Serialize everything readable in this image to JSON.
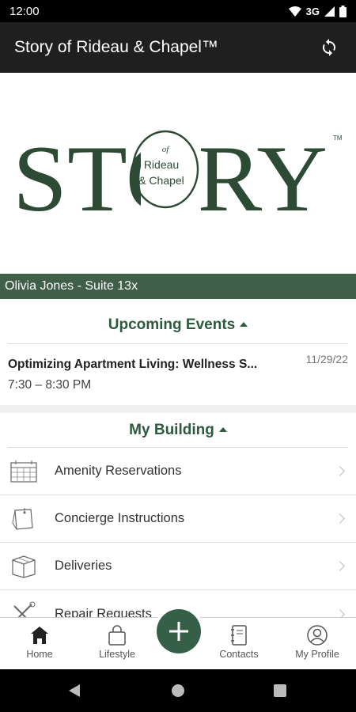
{
  "status_bar": {
    "time": "12:00",
    "network": "3G"
  },
  "app_bar": {
    "title": "Story of Rideau & Chapel™"
  },
  "logo": {
    "main_text": "STORY",
    "of_text": "of",
    "line1": "Rideau",
    "line2": "& Chapel",
    "tm": "TM",
    "color": "#2d4a35"
  },
  "resident": {
    "label": "Olivia Jones - Suite 13x"
  },
  "upcoming_events": {
    "title": "Upcoming Events",
    "events": [
      {
        "title": "Optimizing Apartment Living: Wellness S...",
        "time": "7:30 – 8:30 PM",
        "date": "11/29/22"
      }
    ]
  },
  "my_building": {
    "title": "My Building",
    "items": [
      {
        "label": "Amenity Reservations",
        "icon": "calendar-icon"
      },
      {
        "label": "Concierge Instructions",
        "icon": "notes-icon"
      },
      {
        "label": "Deliveries",
        "icon": "package-icon"
      },
      {
        "label": "Repair Requests",
        "icon": "tools-icon"
      }
    ]
  },
  "bottom_nav": {
    "items": [
      {
        "label": "Home",
        "icon": "home-icon",
        "active": true
      },
      {
        "label": "Lifestyle",
        "icon": "shopping-bag-icon"
      },
      {
        "label": "Contacts",
        "icon": "address-book-icon"
      },
      {
        "label": "My Profile",
        "icon": "user-circle-icon"
      }
    ],
    "add_icon": "plus-icon"
  },
  "colors": {
    "brand_green": "#2d5a3d",
    "resident_bar": "#3f5f49",
    "app_bar": "#1f1f1f",
    "fab": "#355f46"
  }
}
